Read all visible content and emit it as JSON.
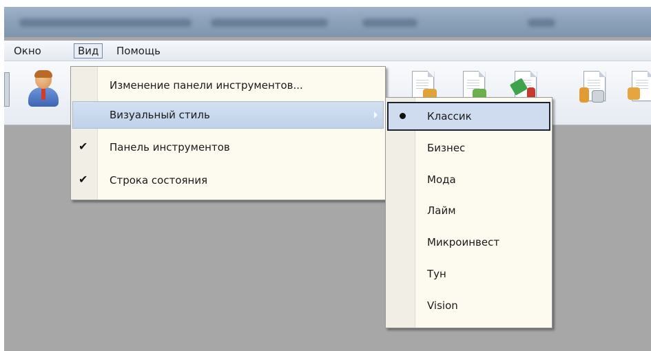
{
  "window": {
    "title": ""
  },
  "menubar": {
    "items": [
      {
        "label": "Окно"
      },
      {
        "label": "Вид"
      },
      {
        "label": "Помощь"
      }
    ]
  },
  "toolbar": {
    "icons": [
      "user-icon",
      "document-icon",
      "document-icon",
      "document-icon",
      "document-icon",
      "document-icon"
    ]
  },
  "view_menu": {
    "items": [
      {
        "label": "Изменение панели инструментов...",
        "checked": false
      },
      {
        "label": "Визуальный стиль",
        "has_submenu": true,
        "highlighted": true
      },
      {
        "label": "Панель инструментов",
        "checked": true,
        "check_icon": "✔"
      },
      {
        "label": "Строка состояния",
        "checked": true,
        "check_icon": "✔"
      }
    ]
  },
  "style_submenu": {
    "selected": "Классик",
    "items": [
      {
        "label": "Классик"
      },
      {
        "label": "Бизнес"
      },
      {
        "label": "Мода"
      },
      {
        "label": "Лайм"
      },
      {
        "label": "Микроинвест"
      },
      {
        "label": "Тун"
      },
      {
        "label": "Vision"
      }
    ]
  },
  "colors": {
    "highlight": "#c9d9ee",
    "menu_background": "#fdfaf0",
    "workspace": "#a7a7a7"
  }
}
